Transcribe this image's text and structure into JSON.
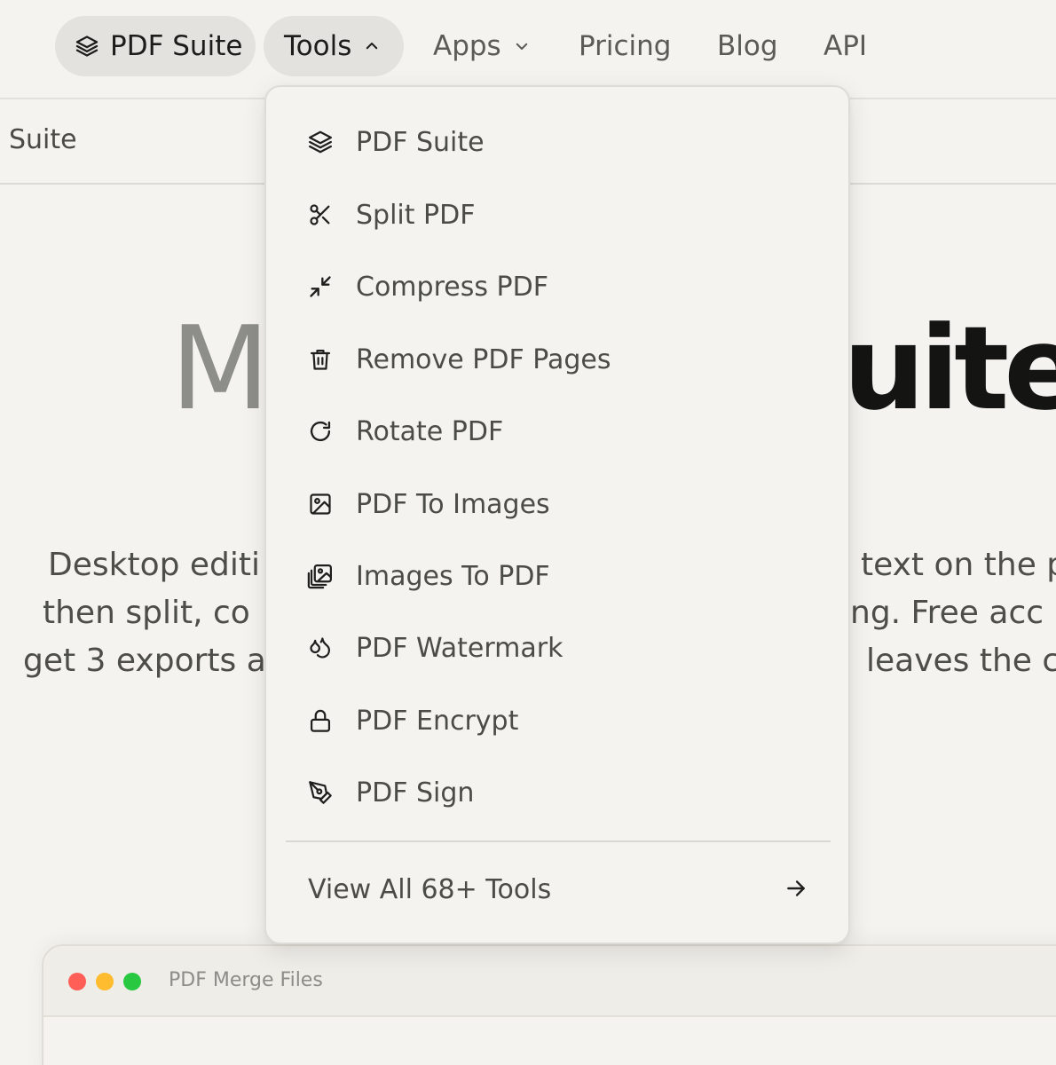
{
  "nav": {
    "brand_label": "PDF Suite",
    "brand_icon": "layers-icon",
    "tools_label": "Tools",
    "apps_label": "Apps",
    "pricing_label": "Pricing",
    "blog_label": "Blog",
    "api_label": "API"
  },
  "subbar": {
    "title": "Suite"
  },
  "hero": {
    "title_left": "M",
    "title_right": "uite",
    "description_lines": [
      {
        "left": "Desktop editi",
        "right": "text on the p"
      },
      {
        "left": "then split, co",
        "right": "ng. Free acc"
      },
      {
        "left": "get 3 exports a",
        "right": "leaves the c"
      }
    ]
  },
  "tools_menu": {
    "items": [
      {
        "label": "PDF Suite",
        "icon": "layers-icon"
      },
      {
        "label": "Split PDF",
        "icon": "scissors-icon"
      },
      {
        "label": "Compress PDF",
        "icon": "minimize-arrows-icon"
      },
      {
        "label": "Remove PDF Pages",
        "icon": "trash-icon"
      },
      {
        "label": "Rotate PDF",
        "icon": "rotate-cw-icon"
      },
      {
        "label": "PDF To Images",
        "icon": "image-icon"
      },
      {
        "label": "Images To PDF",
        "icon": "images-stack-icon"
      },
      {
        "label": "PDF Watermark",
        "icon": "droplets-icon"
      },
      {
        "label": "PDF Encrypt",
        "icon": "lock-icon"
      },
      {
        "label": "PDF Sign",
        "icon": "pen-nib-icon"
      }
    ],
    "view_all_label": "View All 68+ Tools",
    "view_all_icon": "arrow-right-icon"
  },
  "app_window": {
    "title": "PDF Merge Files",
    "traffic_light_colors": [
      "#ff5f57",
      "#febc2e",
      "#28c840"
    ]
  }
}
